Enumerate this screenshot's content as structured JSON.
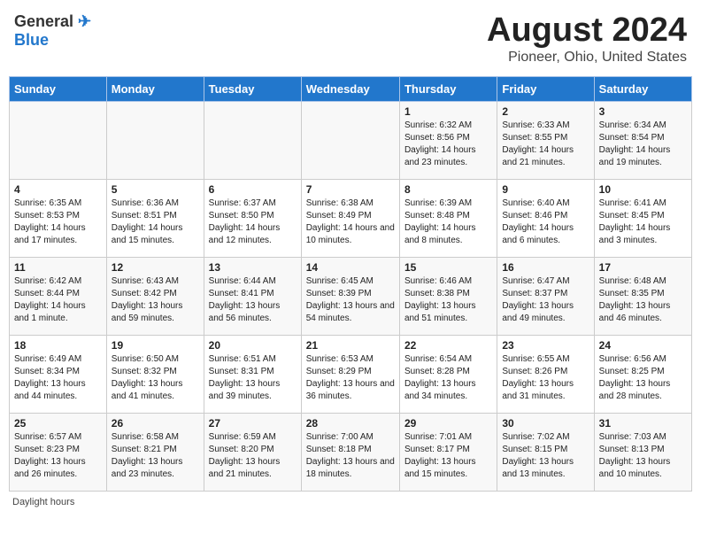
{
  "header": {
    "logo_general": "General",
    "logo_blue": "Blue",
    "main_title": "August 2024",
    "subtitle": "Pioneer, Ohio, United States"
  },
  "days_of_week": [
    "Sunday",
    "Monday",
    "Tuesday",
    "Wednesday",
    "Thursday",
    "Friday",
    "Saturday"
  ],
  "weeks": [
    [
      {
        "day": "",
        "info": ""
      },
      {
        "day": "",
        "info": ""
      },
      {
        "day": "",
        "info": ""
      },
      {
        "day": "",
        "info": ""
      },
      {
        "day": "1",
        "info": "Sunrise: 6:32 AM\nSunset: 8:56 PM\nDaylight: 14 hours and 23 minutes."
      },
      {
        "day": "2",
        "info": "Sunrise: 6:33 AM\nSunset: 8:55 PM\nDaylight: 14 hours and 21 minutes."
      },
      {
        "day": "3",
        "info": "Sunrise: 6:34 AM\nSunset: 8:54 PM\nDaylight: 14 hours and 19 minutes."
      }
    ],
    [
      {
        "day": "4",
        "info": "Sunrise: 6:35 AM\nSunset: 8:53 PM\nDaylight: 14 hours and 17 minutes."
      },
      {
        "day": "5",
        "info": "Sunrise: 6:36 AM\nSunset: 8:51 PM\nDaylight: 14 hours and 15 minutes."
      },
      {
        "day": "6",
        "info": "Sunrise: 6:37 AM\nSunset: 8:50 PM\nDaylight: 14 hours and 12 minutes."
      },
      {
        "day": "7",
        "info": "Sunrise: 6:38 AM\nSunset: 8:49 PM\nDaylight: 14 hours and 10 minutes."
      },
      {
        "day": "8",
        "info": "Sunrise: 6:39 AM\nSunset: 8:48 PM\nDaylight: 14 hours and 8 minutes."
      },
      {
        "day": "9",
        "info": "Sunrise: 6:40 AM\nSunset: 8:46 PM\nDaylight: 14 hours and 6 minutes."
      },
      {
        "day": "10",
        "info": "Sunrise: 6:41 AM\nSunset: 8:45 PM\nDaylight: 14 hours and 3 minutes."
      }
    ],
    [
      {
        "day": "11",
        "info": "Sunrise: 6:42 AM\nSunset: 8:44 PM\nDaylight: 14 hours and 1 minute."
      },
      {
        "day": "12",
        "info": "Sunrise: 6:43 AM\nSunset: 8:42 PM\nDaylight: 13 hours and 59 minutes."
      },
      {
        "day": "13",
        "info": "Sunrise: 6:44 AM\nSunset: 8:41 PM\nDaylight: 13 hours and 56 minutes."
      },
      {
        "day": "14",
        "info": "Sunrise: 6:45 AM\nSunset: 8:39 PM\nDaylight: 13 hours and 54 minutes."
      },
      {
        "day": "15",
        "info": "Sunrise: 6:46 AM\nSunset: 8:38 PM\nDaylight: 13 hours and 51 minutes."
      },
      {
        "day": "16",
        "info": "Sunrise: 6:47 AM\nSunset: 8:37 PM\nDaylight: 13 hours and 49 minutes."
      },
      {
        "day": "17",
        "info": "Sunrise: 6:48 AM\nSunset: 8:35 PM\nDaylight: 13 hours and 46 minutes."
      }
    ],
    [
      {
        "day": "18",
        "info": "Sunrise: 6:49 AM\nSunset: 8:34 PM\nDaylight: 13 hours and 44 minutes."
      },
      {
        "day": "19",
        "info": "Sunrise: 6:50 AM\nSunset: 8:32 PM\nDaylight: 13 hours and 41 minutes."
      },
      {
        "day": "20",
        "info": "Sunrise: 6:51 AM\nSunset: 8:31 PM\nDaylight: 13 hours and 39 minutes."
      },
      {
        "day": "21",
        "info": "Sunrise: 6:53 AM\nSunset: 8:29 PM\nDaylight: 13 hours and 36 minutes."
      },
      {
        "day": "22",
        "info": "Sunrise: 6:54 AM\nSunset: 8:28 PM\nDaylight: 13 hours and 34 minutes."
      },
      {
        "day": "23",
        "info": "Sunrise: 6:55 AM\nSunset: 8:26 PM\nDaylight: 13 hours and 31 minutes."
      },
      {
        "day": "24",
        "info": "Sunrise: 6:56 AM\nSunset: 8:25 PM\nDaylight: 13 hours and 28 minutes."
      }
    ],
    [
      {
        "day": "25",
        "info": "Sunrise: 6:57 AM\nSunset: 8:23 PM\nDaylight: 13 hours and 26 minutes."
      },
      {
        "day": "26",
        "info": "Sunrise: 6:58 AM\nSunset: 8:21 PM\nDaylight: 13 hours and 23 minutes."
      },
      {
        "day": "27",
        "info": "Sunrise: 6:59 AM\nSunset: 8:20 PM\nDaylight: 13 hours and 21 minutes."
      },
      {
        "day": "28",
        "info": "Sunrise: 7:00 AM\nSunset: 8:18 PM\nDaylight: 13 hours and 18 minutes."
      },
      {
        "day": "29",
        "info": "Sunrise: 7:01 AM\nSunset: 8:17 PM\nDaylight: 13 hours and 15 minutes."
      },
      {
        "day": "30",
        "info": "Sunrise: 7:02 AM\nSunset: 8:15 PM\nDaylight: 13 hours and 13 minutes."
      },
      {
        "day": "31",
        "info": "Sunrise: 7:03 AM\nSunset: 8:13 PM\nDaylight: 13 hours and 10 minutes."
      }
    ]
  ],
  "footer": {
    "daylight_label": "Daylight hours"
  }
}
